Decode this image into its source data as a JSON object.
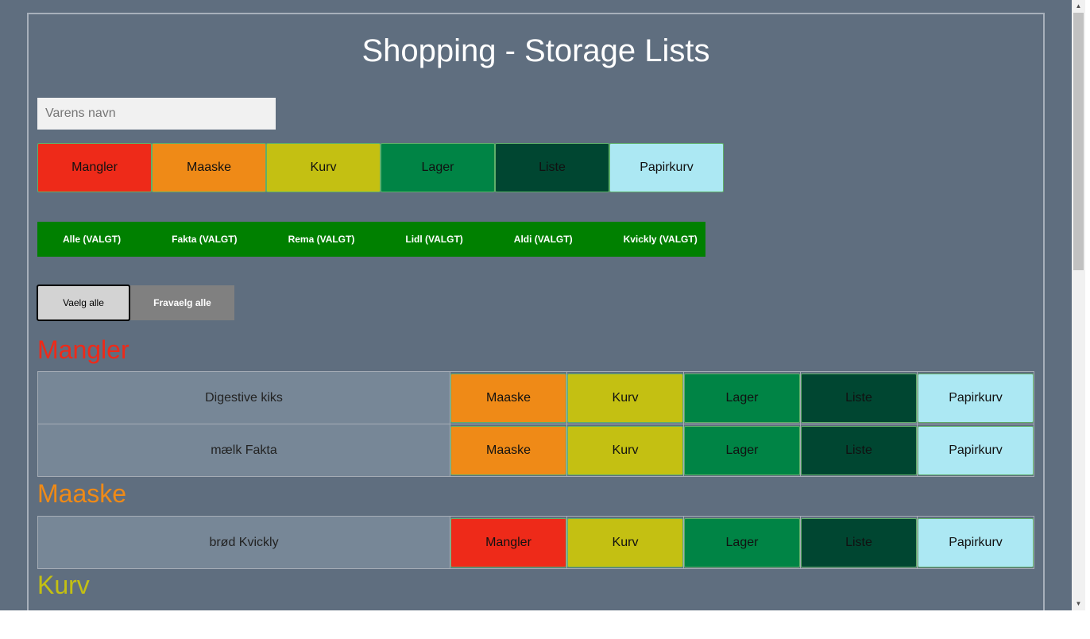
{
  "page": {
    "title": "Shopping - Storage Lists"
  },
  "search": {
    "placeholder": "Varens navn",
    "value": ""
  },
  "categories": [
    {
      "label": "Mangler",
      "color": "#ee2a19"
    },
    {
      "label": "Maaske",
      "color": "#ef8a17"
    },
    {
      "label": "Kurv",
      "color": "#c4c012"
    },
    {
      "label": "Lager",
      "color": "#008445"
    },
    {
      "label": "Liste",
      "color": "#004631"
    },
    {
      "label": "Papirkurv",
      "color": "#ace8f3"
    }
  ],
  "stores": [
    "Alle (VALGT)",
    "Fakta (VALGT)",
    "Rema (VALGT)",
    "Lidl (VALGT)",
    "Aldi (VALGT)",
    "Kvickly (VALGT)"
  ],
  "selection": {
    "select_all": "Vaelg alle",
    "deselect_all": "Fravaelg alle"
  },
  "sections": [
    {
      "title": "Mangler",
      "color": "#ee2a19",
      "rows": [
        {
          "name": "Digestive kiks",
          "actions": [
            "Maaske",
            "Kurv",
            "Lager",
            "Liste",
            "Papirkurv"
          ]
        },
        {
          "name": "mælk Fakta",
          "actions": [
            "Maaske",
            "Kurv",
            "Lager",
            "Liste",
            "Papirkurv"
          ]
        }
      ]
    },
    {
      "title": "Maaske",
      "color": "#ef8a17",
      "rows": [
        {
          "name": "brød Kvickly",
          "actions": [
            "Mangler",
            "Kurv",
            "Lager",
            "Liste",
            "Papirkurv"
          ]
        }
      ]
    },
    {
      "title": "Kurv",
      "color": "#c4c012",
      "rows": []
    }
  ]
}
